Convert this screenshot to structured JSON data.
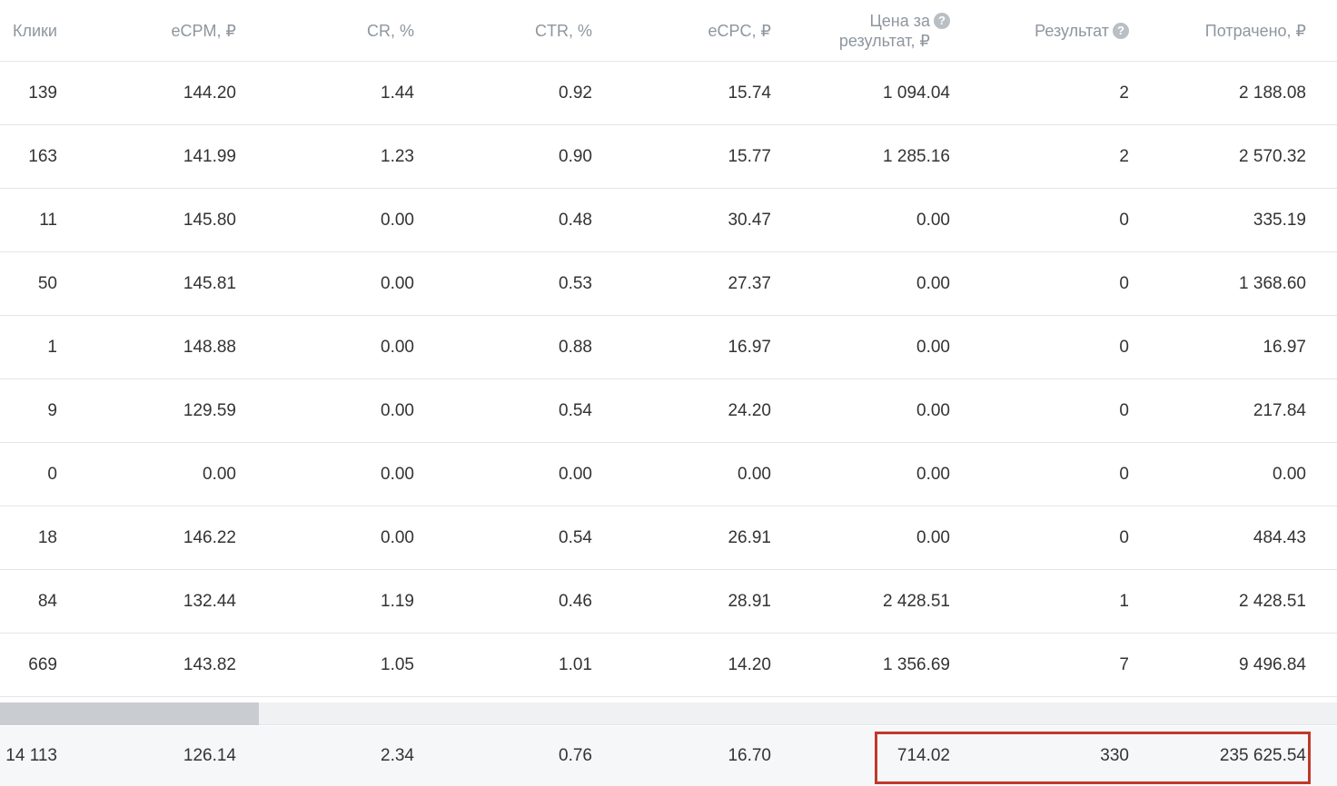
{
  "columns": {
    "clicks": "Клики",
    "ecpm": "eCPM, ₽",
    "cr": "CR, %",
    "ctr": "CTR, %",
    "ecpc": "eCPC, ₽",
    "price_line1": "Цена за",
    "price_line2": "результат, ₽",
    "result": "Результат",
    "spent": "Потрачено, ₽",
    "help_glyph": "?"
  },
  "rows": [
    {
      "clicks": "139",
      "ecpm": "144.20",
      "cr": "1.44",
      "ctr": "0.92",
      "ecpc": "15.74",
      "price": "1 094.04",
      "result": "2",
      "spent": "2 188.08"
    },
    {
      "clicks": "163",
      "ecpm": "141.99",
      "cr": "1.23",
      "ctr": "0.90",
      "ecpc": "15.77",
      "price": "1 285.16",
      "result": "2",
      "spent": "2 570.32"
    },
    {
      "clicks": "11",
      "ecpm": "145.80",
      "cr": "0.00",
      "ctr": "0.48",
      "ecpc": "30.47",
      "price": "0.00",
      "result": "0",
      "spent": "335.19"
    },
    {
      "clicks": "50",
      "ecpm": "145.81",
      "cr": "0.00",
      "ctr": "0.53",
      "ecpc": "27.37",
      "price": "0.00",
      "result": "0",
      "spent": "1 368.60"
    },
    {
      "clicks": "1",
      "ecpm": "148.88",
      "cr": "0.00",
      "ctr": "0.88",
      "ecpc": "16.97",
      "price": "0.00",
      "result": "0",
      "spent": "16.97"
    },
    {
      "clicks": "9",
      "ecpm": "129.59",
      "cr": "0.00",
      "ctr": "0.54",
      "ecpc": "24.20",
      "price": "0.00",
      "result": "0",
      "spent": "217.84"
    },
    {
      "clicks": "0",
      "ecpm": "0.00",
      "cr": "0.00",
      "ctr": "0.00",
      "ecpc": "0.00",
      "price": "0.00",
      "result": "0",
      "spent": "0.00"
    },
    {
      "clicks": "18",
      "ecpm": "146.22",
      "cr": "0.00",
      "ctr": "0.54",
      "ecpc": "26.91",
      "price": "0.00",
      "result": "0",
      "spent": "484.43"
    },
    {
      "clicks": "84",
      "ecpm": "132.44",
      "cr": "1.19",
      "ctr": "0.46",
      "ecpc": "28.91",
      "price": "2 428.51",
      "result": "1",
      "spent": "2 428.51"
    },
    {
      "clicks": "669",
      "ecpm": "143.82",
      "cr": "1.05",
      "ctr": "1.01",
      "ecpc": "14.20",
      "price": "1 356.69",
      "result": "7",
      "spent": "9 496.84"
    }
  ],
  "totals": {
    "clicks": "14 113",
    "ecpm": "126.14",
    "cr": "2.34",
    "ctr": "0.76",
    "ecpc": "16.70",
    "price": "714.02",
    "result": "330",
    "spent": "235 625.54"
  },
  "colors": {
    "highlight": "#c0392b",
    "header_text": "#8e969e",
    "cell_text": "#333333",
    "divider": "#e3e6ea"
  }
}
